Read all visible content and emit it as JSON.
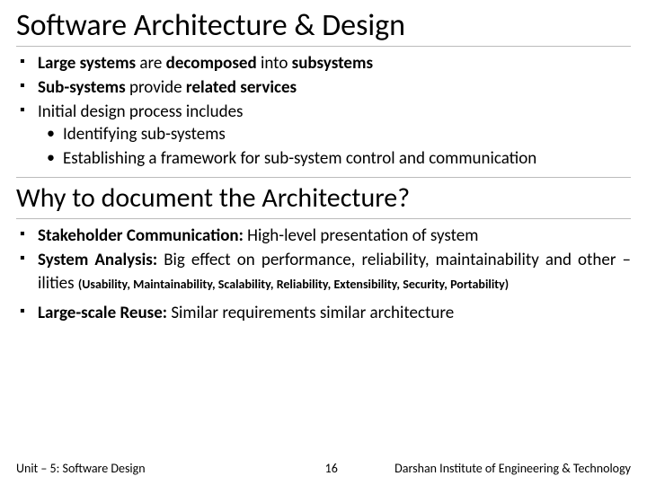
{
  "slide": {
    "title1": "Software Architecture & Design",
    "title2": "Why to document the Architecture?",
    "section1": {
      "b1": {
        "bold1": "Large systems",
        "plain1": " are ",
        "bold2": "decomposed",
        "plain2": " into ",
        "bold3": "subsystems"
      },
      "b2": {
        "bold1": "Sub-systems",
        "plain1": " provide ",
        "bold2": "related services"
      },
      "b3": {
        "plain1": "Initial design process includes"
      },
      "b3a": {
        "plain1": "Identifying sub-systems"
      },
      "b3b": {
        "plain1": "Establishing a framework for sub-system control and communication"
      }
    },
    "section2": {
      "b1": {
        "bold1": "Stakeholder Communication:",
        "plain1": " High-level presentation of system"
      },
      "b2": {
        "bold1": "System Analysis:",
        "plain1": " Big effect on performance, reliability, maintainability and other –ilities ",
        "small1": "(Usability, Maintainability, Scalability, Reliability, Extensibility, Security, Portability)"
      },
      "b3": {
        "bold1": "Large-scale Reuse:",
        "plain1": " Similar requirements similar architecture"
      }
    }
  },
  "footer": {
    "unit": "Unit – 5: Software Design",
    "page": "16",
    "institute": "Darshan Institute of Engineering & Technology"
  }
}
